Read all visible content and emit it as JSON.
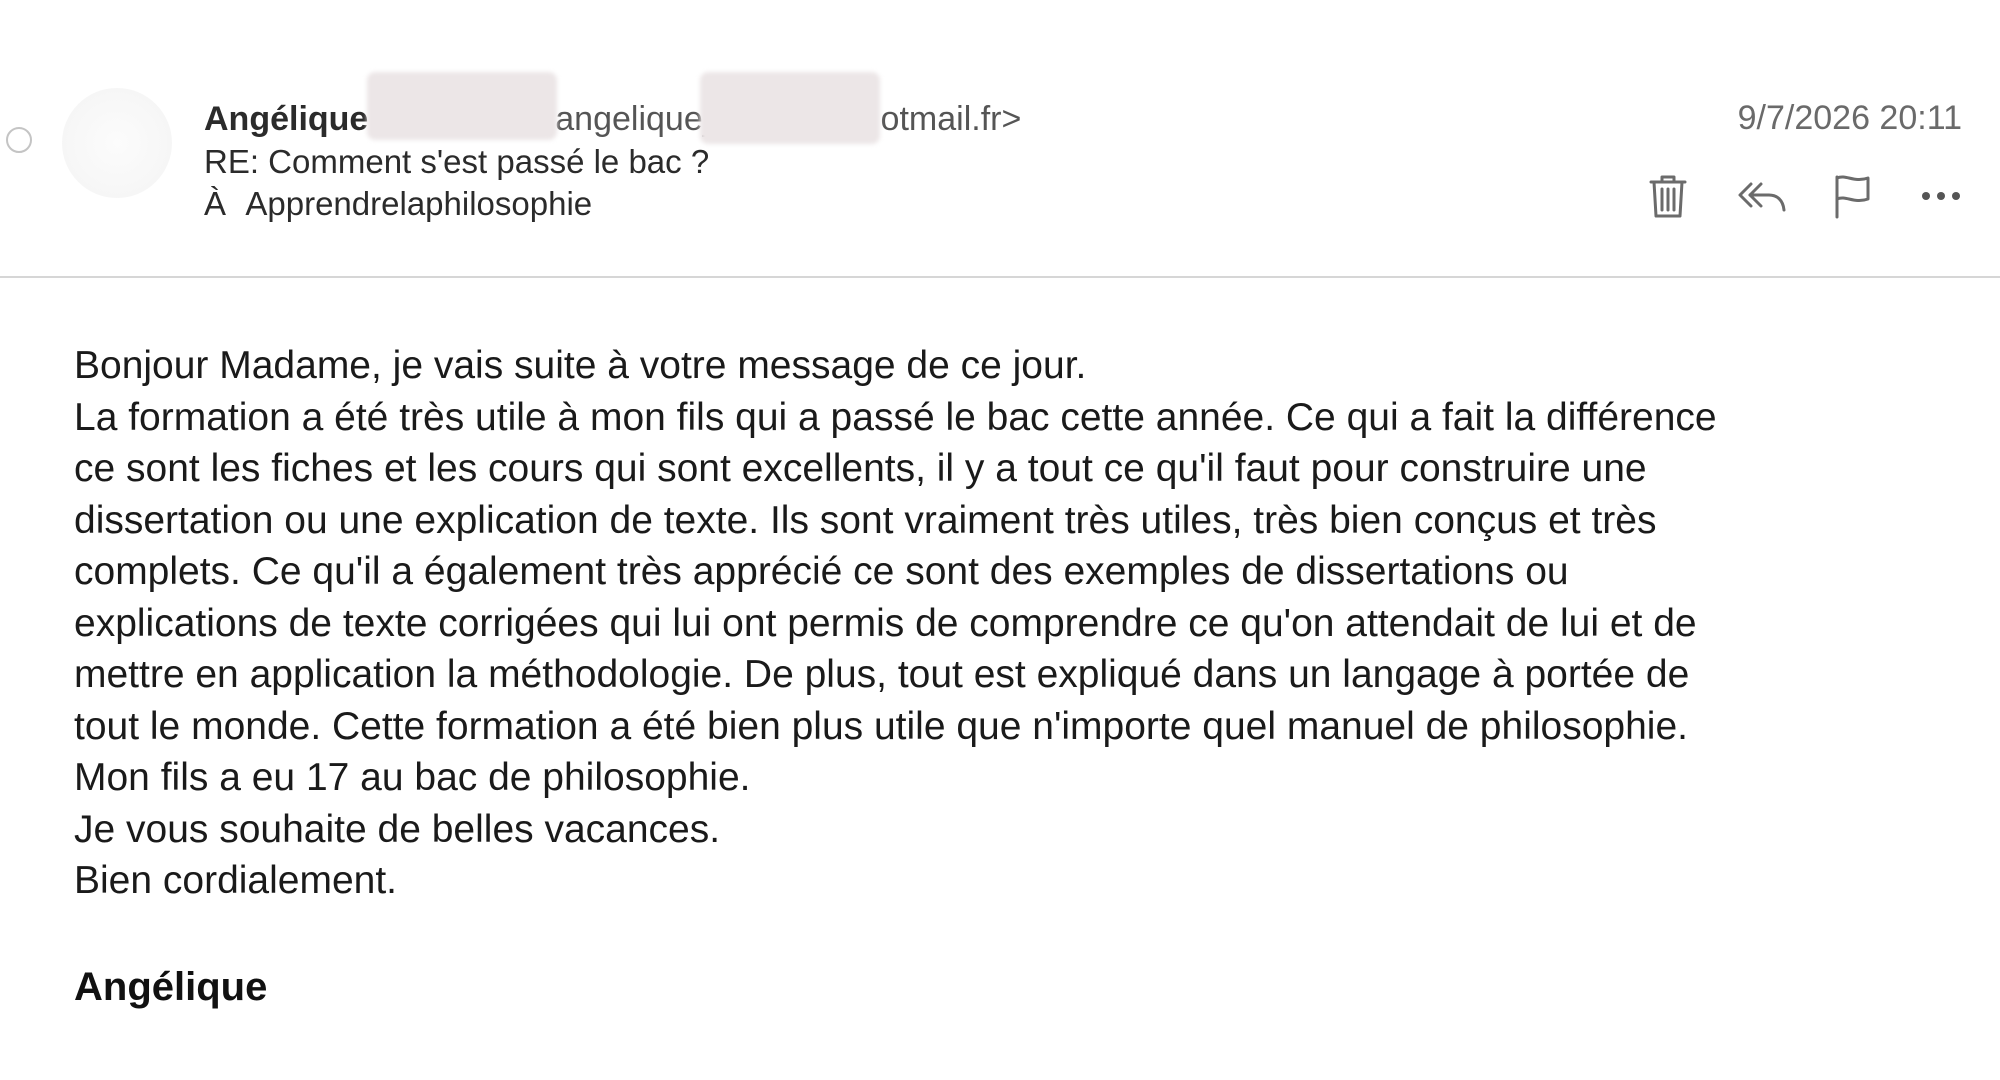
{
  "email": {
    "sender_name": "Angélique",
    "sender_address_visible": "angelique_",
    "sender_address_tail": "otmail.fr>",
    "subject": "RE: Comment s'est passé le bac ?",
    "to_prefix": "À",
    "to": "Apprendrelaphilosophie",
    "date": "9/7/2026 20:11"
  },
  "toolbar": {
    "icons": [
      "trash-icon",
      "reply-all-icon",
      "flag-icon",
      "more-icon"
    ]
  },
  "body": {
    "greeting": "Bonjour Madame, je vais suite à votre message de ce jour.",
    "line_1": "La formation a été très utile à mon fils qui a passé le bac cette année. Ce qui a fait la différence",
    "line_2": "ce sont les fiches et les cours qui sont excellents, il y a tout ce qu'il faut pour construire une",
    "line_3": "dissertation ou une explication de texte. Ils sont vraiment très utiles, très bien conçus et très",
    "line_4": "complets. Ce qu'il a également très apprécié ce sont des exemples de dissertations ou",
    "line_5": "explications de texte corrigées qui lui ont permis de comprendre ce qu'on attendait de lui et de",
    "line_6": "mettre en application la méthodologie. De plus, tout est expliqué dans un langage à portée de",
    "line_7": "tout le monde. Cette formation a été bien plus utile que n'importe quel manuel de philosophie.",
    "result": "Mon fils a eu 17 au bac de philosophie.",
    "wishes": "Je vous souhaite de belles vacances.",
    "closing": "Bien cordialement.",
    "signature": "Angélique"
  },
  "colors": {
    "text": "#1a1a1a",
    "muted": "#6a6a6a",
    "divider": "#d6d6d6",
    "icon": "#6b6b6b",
    "redaction": "#ece6e7"
  }
}
